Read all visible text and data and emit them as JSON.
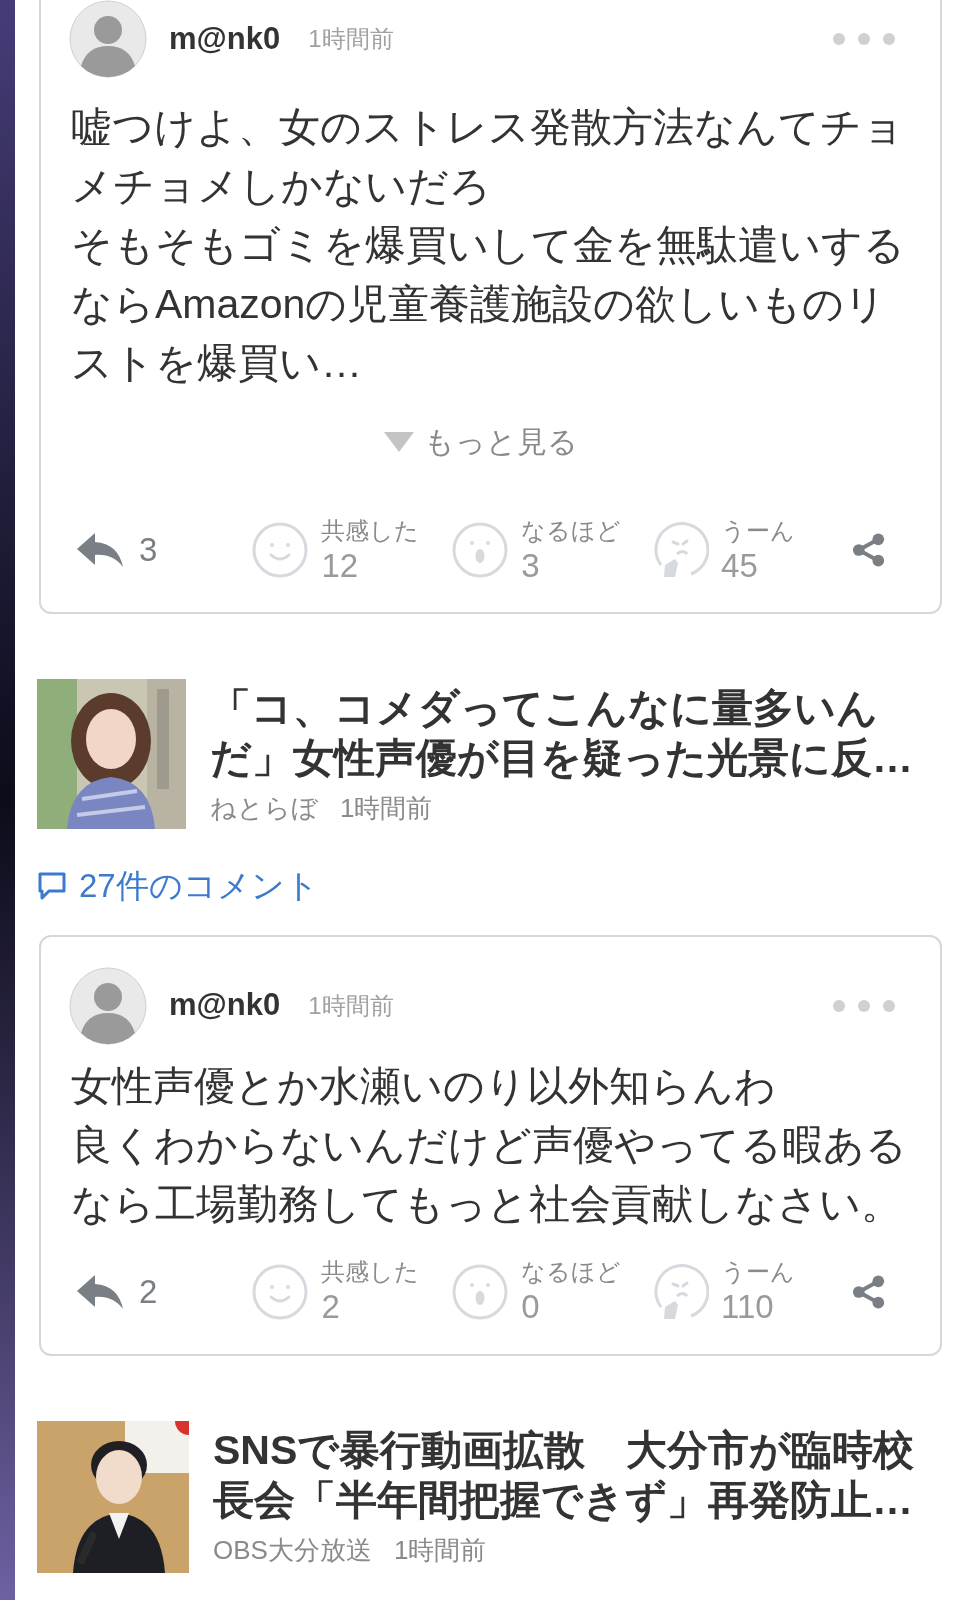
{
  "items": [
    {
      "kind": "comment",
      "user": "m@nk0",
      "time": "1時間前",
      "paragraphs": [
        "嘘つけよ、女のストレス発散方法なんてチョメチョメしかないだろ",
        "そもそもゴミを爆買いして金を無駄遣いするならAmazonの児童養護施設の欲しいものリストを爆買い…"
      ],
      "more": "もっと見る",
      "replies": "3",
      "reactions": [
        {
          "kind": "empathy",
          "label": "共感した",
          "count": "12"
        },
        {
          "kind": "insight",
          "label": "なるほど",
          "count": "3"
        },
        {
          "kind": "hmm",
          "label": "うーん",
          "count": "45"
        }
      ]
    },
    {
      "kind": "article",
      "title": "「コ、コメダってこんなに量多いんだ」女性声優が目を疑った光景に反…",
      "source": "ねとらぼ",
      "time": "1時間前"
    },
    {
      "kind": "comment_link",
      "label": "27件のコメント"
    },
    {
      "kind": "comment",
      "user": "m@nk0",
      "time": "1時間前",
      "paragraphs": [
        "女性声優とか水瀬いのり以外知らんわ",
        "良くわからないんだけど声優やってる暇あるなら工場勤務してもっと社会貢献しなさい。"
      ],
      "replies": "2",
      "reactions": [
        {
          "kind": "empathy",
          "label": "共感した",
          "count": "2"
        },
        {
          "kind": "insight",
          "label": "なるほど",
          "count": "0"
        },
        {
          "kind": "hmm",
          "label": "うーん",
          "count": "110"
        }
      ]
    },
    {
      "kind": "article",
      "title": "SNSで暴行動画拡散　大分市が臨時校長会「半年間把握できず」再発防止…",
      "source": "OBS大分放送",
      "time": "1時間前"
    }
  ]
}
